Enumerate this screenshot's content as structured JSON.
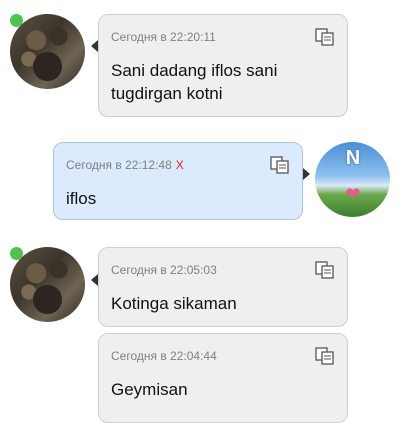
{
  "messages": [
    {
      "direction": "incoming",
      "time": "Сегодня в 22:20:11",
      "text": "Sani dadang iflos sani tugdirgan kotni"
    },
    {
      "direction": "outgoing",
      "time": "Сегодня в 22:12:48",
      "status_mark": "X",
      "text": "iflos"
    },
    {
      "direction": "incoming",
      "time": "Сегодня в 22:05:03",
      "text": "Kotinga sikaman"
    },
    {
      "direction": "incoming",
      "time": "Сегодня в 22:04:44",
      "text": "Geymisan"
    }
  ],
  "icons": {
    "copy": "copy-icon",
    "online": "online-indicator"
  },
  "colors": {
    "incoming_bubble": "#efefef",
    "outgoing_bubble": "#dbeafd",
    "status_x": "#e0261c",
    "online_dot": "#4fc24f"
  }
}
